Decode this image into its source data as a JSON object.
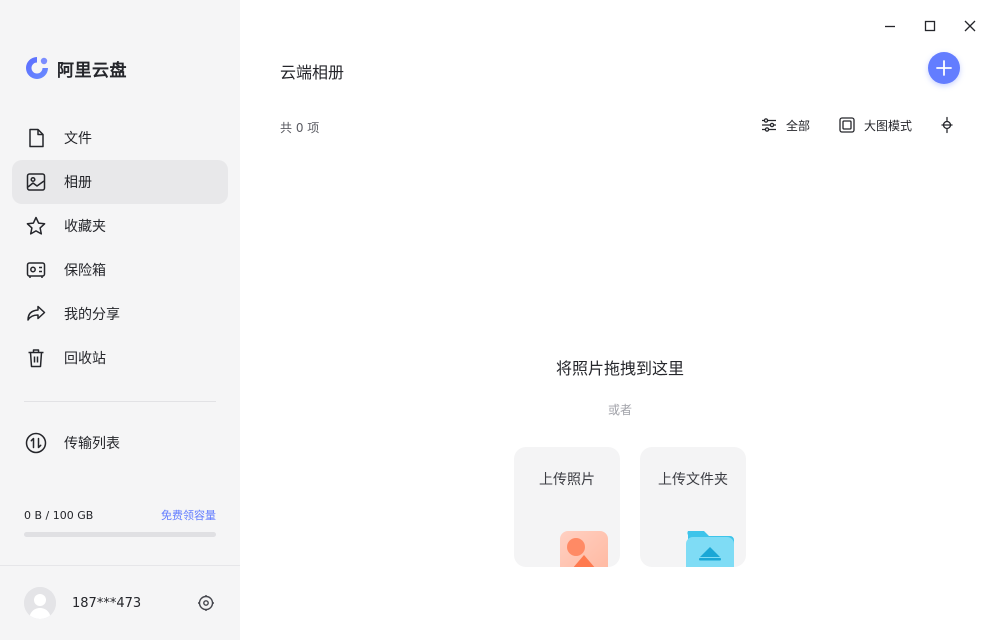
{
  "app": {
    "name": "阿里云盘",
    "accent": "#637dff"
  },
  "window_controls": [
    "minimize-icon",
    "maximize-icon",
    "close-icon"
  ],
  "sidebar": {
    "items": [
      {
        "label": "文件",
        "icon": "file-icon",
        "active": false
      },
      {
        "label": "相册",
        "icon": "album-icon",
        "active": true
      },
      {
        "label": "收藏夹",
        "icon": "star-icon",
        "active": false
      },
      {
        "label": "保险箱",
        "icon": "safe-icon",
        "active": false
      },
      {
        "label": "我的分享",
        "icon": "share-icon",
        "active": false
      },
      {
        "label": "回收站",
        "icon": "trash-icon",
        "active": false
      }
    ],
    "transfer": {
      "label": "传输列表",
      "icon": "transfer-icon"
    },
    "storage": {
      "used_text": "0 B / 100 GB",
      "link": "免费领容量",
      "used_fraction": 0
    },
    "user": {
      "name": "187***473",
      "settings_icon": "settings-icon"
    }
  },
  "main": {
    "title": "云端相册",
    "add_icon": "plus-icon",
    "count_text": "共 0 项",
    "toolbar": {
      "filter_label": "全部",
      "view_label": "大图模式",
      "sort_icon": "sort-icon"
    },
    "empty": {
      "title": "将照片拖拽到这里",
      "or": "或者",
      "upload_photo": "上传照片",
      "upload_folder": "上传文件夹"
    }
  }
}
